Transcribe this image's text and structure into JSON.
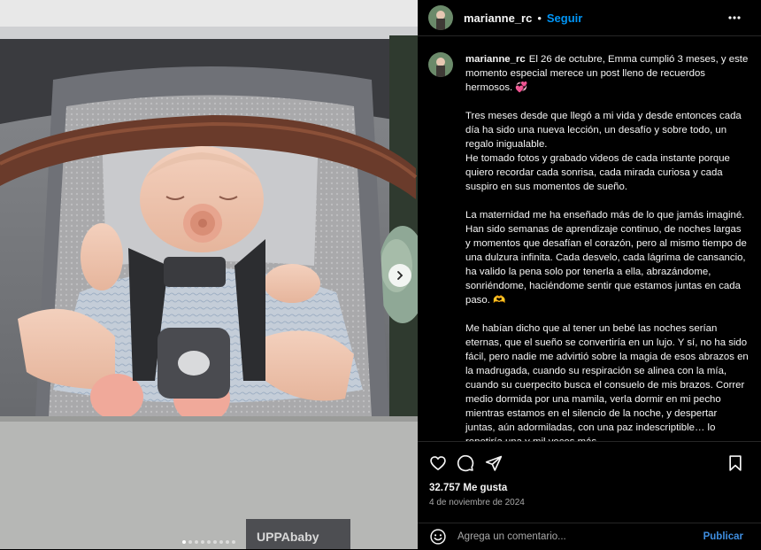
{
  "post": {
    "username": "marianne_rc",
    "follow_label": "Seguir",
    "bullet": "•",
    "caption": {
      "paragraph_1": "El 26 de octubre, Emma cumplió 3 meses, y este momento especial merece un post lleno de recuerdos hermosos. 💞",
      "paragraph_2": "Tres meses desde que llegó a mi vida y desde entonces cada día ha sido una nueva lección, un desafío y sobre todo, un regalo inigualable.\nHe tomado fotos y grabado videos de cada instante porque quiero recordar cada sonrisa, cada mirada curiosa y cada suspiro en sus momentos de sueño.",
      "paragraph_3": "La maternidad me ha enseñado más de lo que jamás imaginé. Han sido semanas de aprendizaje continuo, de noches largas y momentos que desafían el corazón, pero al mismo tiempo de una dulzura infinita. Cada desvelo, cada lágrima de cansancio, ha valido la pena solo por tenerla a ella, abrazándome, sonriéndome, haciéndome sentir que estamos juntas en cada paso. 🫶",
      "paragraph_4": "Me habían dicho que al tener un bebé las noches serían eternas, que el sueño se convertiría en un lujo. Y sí, no ha sido fácil, pero nadie me advirtió sobre la magia de esos abrazos en la madrugada, cuando su respiración se alinea con la mía, cuando su cuerpecito busca el consuelo de mis brazos. Correr medio dormida por una mamila, verla dormir en mi pecho mientras estamos en el silencio de la noche, y despertar juntas, aún adormiladas, con una paz indescriptible… lo repetiría una y mil veces más."
    },
    "likes": "32.757 Me gusta",
    "date": "4 de noviembre de 2024",
    "comment_placeholder": "Agrega un comentario...",
    "publish_label": "Publicar",
    "photo_logo_text": "UPPAbaby",
    "carousel": {
      "count": 9,
      "active_index": 0
    }
  },
  "icons": {
    "more": "more-options-icon",
    "like": "heart-icon",
    "comment": "comment-icon",
    "share": "share-icon",
    "save": "bookmark-icon",
    "emoji": "emoji-icon",
    "next": "chevron-right-icon"
  },
  "colors": {
    "background": "#000000",
    "accent_blue": "#0095f6",
    "publish_blue": "#3f8ee0",
    "secondary_text": "#a8a8a8",
    "divider": "#262626"
  }
}
